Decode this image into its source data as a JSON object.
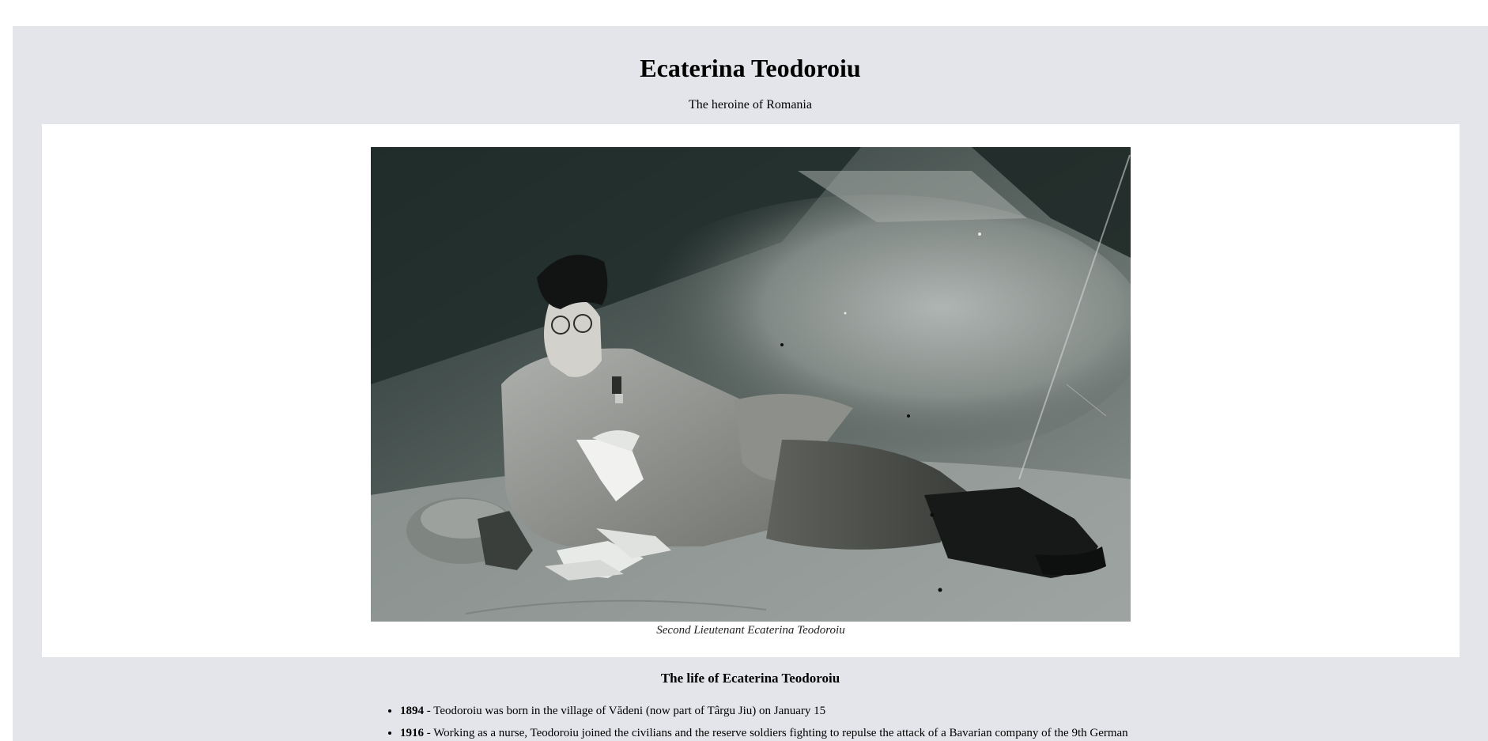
{
  "page": {
    "title": "Ecaterina Teodoroiu",
    "subtitle": "The heroine of Romania"
  },
  "figure": {
    "image_alt": "Second Lieutenant Ecaterina Teodoroiu reclining in military uniform",
    "caption": "Second Lieutenant Ecaterina Teodoroiu"
  },
  "life": {
    "heading": "The life of Ecaterina Teodoroiu",
    "items": [
      {
        "year": "1894",
        "text": " - Teodoroiu was born in the village of Vădeni (now part of Târgu Jiu) on January 15"
      },
      {
        "year": "1916",
        "text": " - Working as a nurse, Teodoroiu joined the civilians and the reserve soldiers fighting to repulse the attack of a Bavarian company of the 9th German"
      }
    ]
  },
  "colors": {
    "page_background": "#ffffff",
    "main_background": "#e4e5ea",
    "figure_panel": "#ffffff"
  }
}
